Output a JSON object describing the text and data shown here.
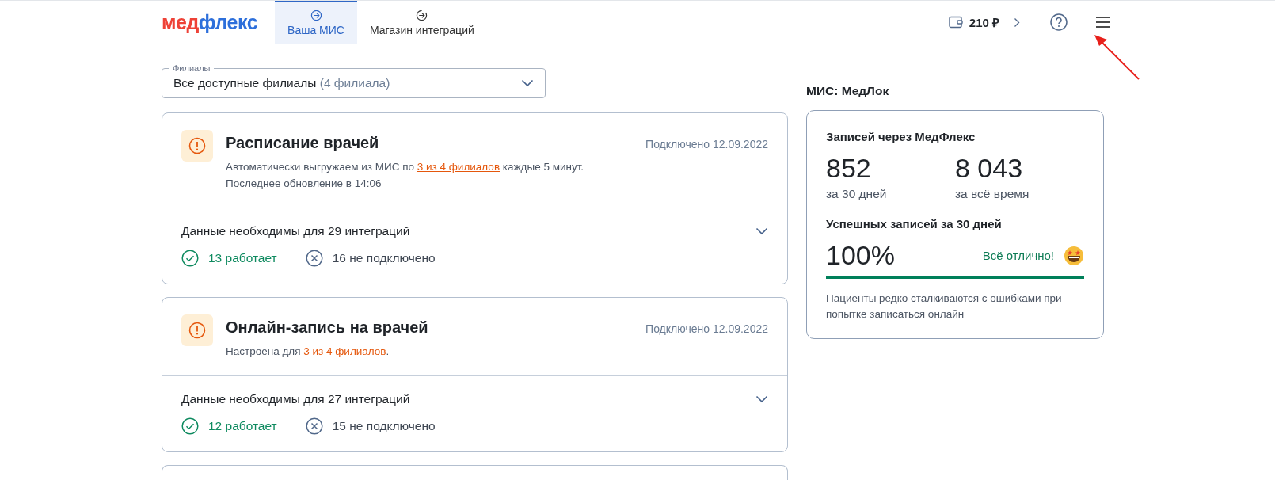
{
  "header": {
    "logo": {
      "part_1": "мед",
      "part_2": "флекс"
    },
    "tabs": [
      {
        "label": "Ваша МИС",
        "selected": true
      },
      {
        "label": "Магазин интеграций",
        "selected": false
      }
    ],
    "balance": "210 ₽"
  },
  "branches_select": {
    "label": "Филиалы",
    "value": "Все доступные филиалы",
    "hint": "(4 филиала)"
  },
  "cards": [
    {
      "title": "Расписание врачей",
      "connected": "Подключено 12.09.2022",
      "lines": [
        {
          "before": "Автоматически выгружаем из МИС по ",
          "link": "3 из 4 филиалов",
          "after": " каждые 5 минут."
        },
        {
          "before": "Последнее обновление в 14:06"
        }
      ],
      "expanded": false,
      "needed": "Данные необходимы для 29 интеграций",
      "working": "13 работает",
      "not_connected": "16 не подключено"
    },
    {
      "title": "Онлайн-запись на врачей",
      "connected": "Подключено 12.09.2022",
      "lines": [
        {
          "before": "Настроена для ",
          "link": "3 из 4 филиалов",
          "after": "."
        }
      ],
      "expanded": false,
      "needed": "Данные необходимы для 27 интеграций",
      "working": "12 работает",
      "not_connected": "15 не подключено"
    }
  ],
  "mis": {
    "title": "МИС: МедЛок",
    "bookings_title": "Записей через МедФлекс",
    "stats": [
      {
        "value": "852",
        "caption": "за 30 дней"
      },
      {
        "value": "8 043",
        "caption": "за всё время"
      }
    ],
    "success_title": "Успешных записей за 30 дней",
    "success_value": "100%",
    "status": "Всё отлично!",
    "level": 1,
    "note": "Пациенты редко сталкиваются с ошибками при попытке записаться онлайн"
  }
}
